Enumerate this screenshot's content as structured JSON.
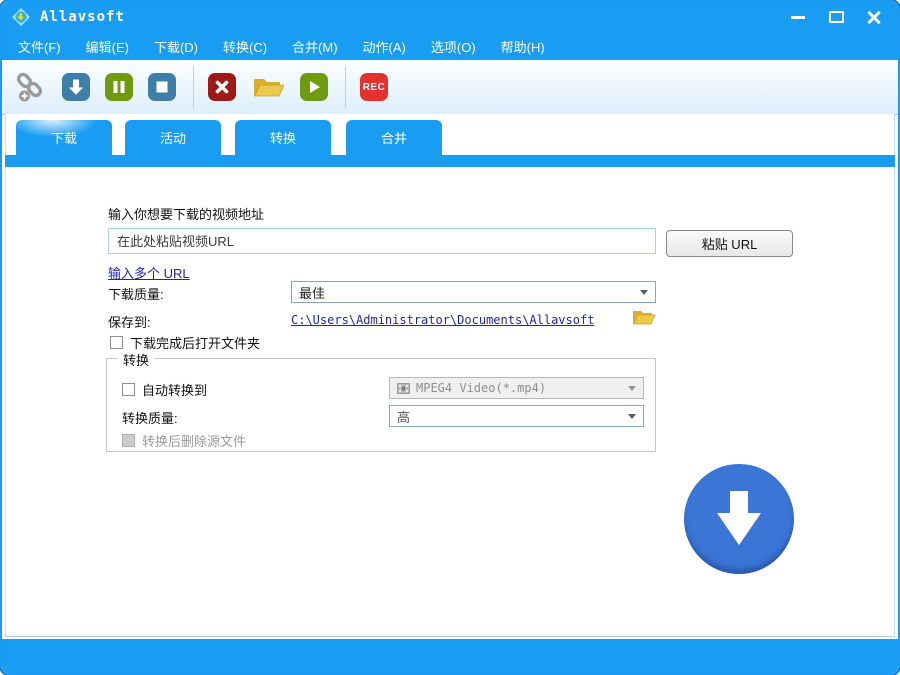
{
  "window": {
    "title": "Allavsoft"
  },
  "menu": {
    "items": [
      "文件(F)",
      "编辑(E)",
      "下载(D)",
      "转换(C)",
      "合并(M)",
      "动作(A)",
      "选项(O)",
      "帮助(H)"
    ]
  },
  "toolbar": {
    "buttons": [
      {
        "icon": "add-link-icon"
      },
      {
        "icon": "download-icon"
      },
      {
        "icon": "pause-icon"
      },
      {
        "icon": "stop-icon"
      },
      {
        "icon": "cancel-icon"
      },
      {
        "icon": "open-folder-icon"
      },
      {
        "icon": "play-icon"
      },
      {
        "icon": "record-icon"
      }
    ],
    "rec_label": "REC"
  },
  "tabs": [
    {
      "label": "下载",
      "active": true
    },
    {
      "label": "活动",
      "active": false
    },
    {
      "label": "转换",
      "active": false
    },
    {
      "label": "合并",
      "active": false
    }
  ],
  "main": {
    "url_label": "输入你想要下载的视频地址",
    "url_placeholder": "在此处粘贴视频URL",
    "paste_button": "粘贴 URL",
    "multi_url_link": "输入多个 URL",
    "download_quality_label": "下载质量:",
    "download_quality_value": "最佳",
    "save_to_label": "保存到:",
    "save_path": "C:\\Users\\Administrator\\Documents\\Allavsoft",
    "open_folder_checkbox_label": "下载完成后打开文件夹",
    "convert": {
      "legend": "转换",
      "auto_convert_label": "自动转换到",
      "format_value": "MPEG4 Video(*.mp4)",
      "quality_label": "转换质量:",
      "quality_value": "高",
      "delete_source_label": "转换后删除源文件"
    }
  },
  "colors": {
    "accent_blue": "#189df2",
    "big_button_blue": "#3b76d6",
    "steel_blue": "#3e7fa9",
    "olive_green": "#6f9b10",
    "dark_red": "#9e1b15",
    "rec_red": "#e53030",
    "folder_yellow": "#e6c13a",
    "link_blue": "#2121cc"
  }
}
